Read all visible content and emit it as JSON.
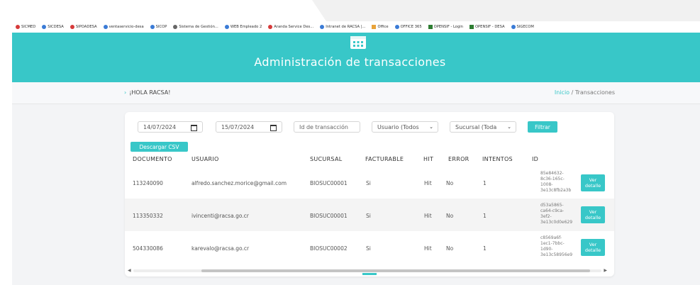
{
  "bookmarks": [
    {
      "label": "SICMED",
      "color": "#d63a3a"
    },
    {
      "label": "SICDESA",
      "color": "#3a7bd6"
    },
    {
      "label": "SIPOADESA",
      "color": "#d63a3a"
    },
    {
      "label": "ventaservicio-desa",
      "color": "#3a7bd6"
    },
    {
      "label": "SICOP",
      "color": "#3a7bd6"
    },
    {
      "label": "Sistema de Gestión...",
      "color": "#666666"
    },
    {
      "label": "WEB Empleado 2",
      "color": "#3a7bd6"
    },
    {
      "label": "Aranda Service Des...",
      "color": "#d63a3a"
    },
    {
      "label": "Intranet de RACSA |...",
      "color": "#3a7bd6"
    },
    {
      "label": "Office",
      "color": "#e8a33a"
    },
    {
      "label": "OFFICE 365",
      "color": "#3a7bd6"
    },
    {
      "label": "OPENSIF - Login",
      "color": "#2e7d32"
    },
    {
      "label": "OPENSIF - DESA",
      "color": "#2e7d32"
    },
    {
      "label": "SIGECOM",
      "color": "#3a7bd6"
    }
  ],
  "header": {
    "title": "Administración de transacciones",
    "icon": "calculator-icon",
    "color": "#38c7c8"
  },
  "breadcrumb": {
    "greeting": "¡HOLA RACSA!",
    "home": "Inicio",
    "separator": "/",
    "current": "Transacciones"
  },
  "filters": {
    "date_from": "14/07/2024",
    "date_to": "15/07/2024",
    "transaction_placeholder": "Id de transacción",
    "user_select": "Usuario (Todos",
    "branch_select": "Sucursal (Toda",
    "filter_button": "Filtrar",
    "download_button": "Descargar CSV"
  },
  "table": {
    "headers": [
      "DOCUMENTO",
      "USUARIO",
      "SUCURSAL",
      "FACTURABLE",
      "HIT",
      "ERROR",
      "INTENTOS",
      "ID"
    ],
    "rows": [
      {
        "documento": "113240090",
        "usuario": "alfredo.sanchez.morice@gmail.com",
        "sucursal": "BIOSUC00001",
        "facturable": "Si",
        "hit": "Hit",
        "error": "No",
        "intentos": "1",
        "id": [
          "85e84632-",
          "8c36-165c-",
          "1008-",
          "3e13c8fb2a3b"
        ],
        "detalle": [
          "Ver",
          "detalle"
        ]
      },
      {
        "documento": "113350332",
        "usuario": "ivincenti@racsa.go.cr",
        "sucursal": "BIOSUC00001",
        "facturable": "Si",
        "hit": "Hit",
        "error": "No",
        "intentos": "1",
        "id": [
          "d53a5865-",
          "ca64-c9ca-",
          "3ef2-",
          "3e13c0d0e629"
        ],
        "detalle": [
          "Ver",
          "detalle"
        ]
      },
      {
        "documento": "504330086",
        "usuario": "karevalo@racsa.go.cr",
        "sucursal": "BIOSUC00002",
        "facturable": "Si",
        "hit": "Hit",
        "error": "No",
        "intentos": "1",
        "id": [
          "c8569a6f-",
          "1ec1-7bbc-",
          "1d90-",
          "3e13c58956e9"
        ],
        "detalle": [
          "Ver",
          "detalle"
        ]
      }
    ]
  }
}
